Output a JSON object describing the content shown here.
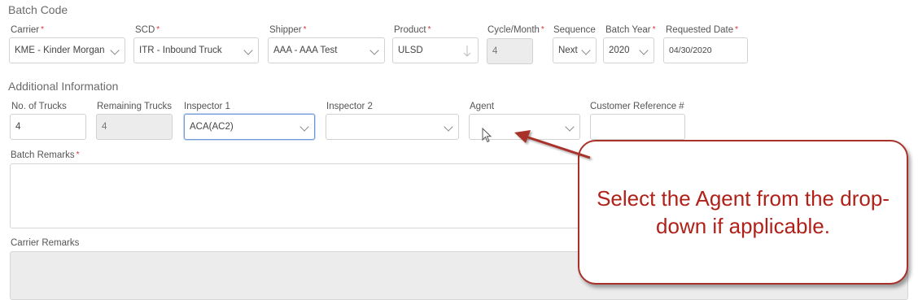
{
  "batch_code": {
    "title": "Batch Code",
    "carrier": {
      "label": "Carrier",
      "value": "KME - Kinder Morgan"
    },
    "scd": {
      "label": "SCD",
      "value": "ITR - Inbound Truck"
    },
    "shipper": {
      "label": "Shipper",
      "value": "AAA - AAA Test"
    },
    "product": {
      "label": "Product",
      "value": "ULSD"
    },
    "cycle": {
      "label": "Cycle/Month",
      "value": "4"
    },
    "sequence": {
      "label": "Sequence",
      "value": "Next"
    },
    "batch_year": {
      "label": "Batch Year",
      "value": "2020"
    },
    "requested_date": {
      "label": "Requested Date",
      "value": "04/30/2020"
    }
  },
  "additional": {
    "title": "Additional Information",
    "trucks": {
      "label": "No. of Trucks",
      "value": "4"
    },
    "remaining": {
      "label": "Remaining Trucks",
      "value": "4"
    },
    "inspector1": {
      "label": "Inspector 1",
      "value": "ACA(AC2)"
    },
    "inspector2": {
      "label": "Inspector 2",
      "value": ""
    },
    "agent": {
      "label": "Agent",
      "value": ""
    },
    "customer_ref": {
      "label": "Customer Reference #",
      "value": ""
    },
    "batch_remarks": {
      "label": "Batch Remarks"
    },
    "carrier_remarks": {
      "label": "Carrier Remarks"
    }
  },
  "callout": {
    "text": "Select the Agent from the drop-down if applicable."
  },
  "colors": {
    "required": "#dd3333",
    "callout": "#b0211a",
    "focus_border": "#6f9bd6"
  },
  "icons": [
    "chevron-down-icon",
    "sort-arrow-icon",
    "mouse-cursor-icon",
    "callout-arrow"
  ]
}
